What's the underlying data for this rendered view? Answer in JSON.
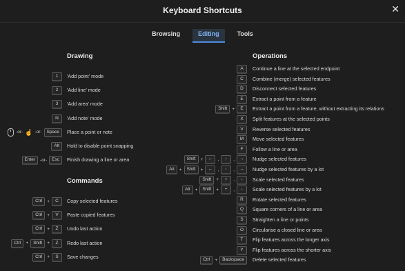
{
  "dialog": {
    "title": "Keyboard Shortcuts",
    "close_icon": "close-icon",
    "close_glyph": "✕"
  },
  "tabs": [
    {
      "label": "Browsing",
      "active": false
    },
    {
      "label": "Editing",
      "active": true
    },
    {
      "label": "Tools",
      "active": false
    }
  ],
  "drawing": {
    "heading": "Drawing",
    "rows": [
      {
        "keys": [
          {
            "k": "1"
          }
        ],
        "desc": "'Add point' mode"
      },
      {
        "keys": [
          {
            "k": "2"
          }
        ],
        "desc": "'Add line' mode"
      },
      {
        "keys": [
          {
            "k": "3"
          }
        ],
        "desc": "'Add area' mode"
      },
      {
        "keys": [
          {
            "k": "N"
          }
        ],
        "desc": "'Add note' mode"
      },
      {
        "keys": [
          {
            "icon": "mouse-icon"
          },
          {
            "sep": "-or-"
          },
          {
            "icon": "hand-pointer-icon"
          },
          {
            "sep": "-or-"
          },
          {
            "k": "Space"
          }
        ],
        "desc": "Place a point or note"
      },
      {
        "keys": [
          {
            "k": "Alt"
          }
        ],
        "desc": "Hold to disable point snapping"
      },
      {
        "keys": [
          {
            "k": "Enter"
          },
          {
            "sep": "-or-"
          },
          {
            "k": "Esc"
          }
        ],
        "desc": "Finish drawing a line or area"
      }
    ]
  },
  "commands": {
    "heading": "Commands",
    "rows": [
      {
        "keys": [
          {
            "k": "Ctrl"
          },
          {
            "sep": "+"
          },
          {
            "k": "C"
          }
        ],
        "desc": "Copy selected features"
      },
      {
        "keys": [
          {
            "k": "Ctrl"
          },
          {
            "sep": "+"
          },
          {
            "k": "V"
          }
        ],
        "desc": "Paste copied features"
      },
      {
        "keys": [
          {
            "k": "Ctrl"
          },
          {
            "sep": "+"
          },
          {
            "k": "Z"
          }
        ],
        "desc": "Undo last action"
      },
      {
        "keys": [
          {
            "k": "Ctrl"
          },
          {
            "sep": "+"
          },
          {
            "k": "Shift"
          },
          {
            "sep": "+"
          },
          {
            "k": "Z"
          }
        ],
        "desc": "Redo last action"
      },
      {
        "keys": [
          {
            "k": "Ctrl"
          },
          {
            "sep": "+"
          },
          {
            "k": "S"
          }
        ],
        "desc": "Save changes"
      }
    ]
  },
  "operations": {
    "heading": "Operations",
    "rows": [
      {
        "keys": [
          {
            "k": "A"
          }
        ],
        "desc": "Continue a line at the selected endpoint"
      },
      {
        "keys": [
          {
            "k": "C"
          }
        ],
        "desc": "Combine (merge) selected features"
      },
      {
        "keys": [
          {
            "k": "D"
          }
        ],
        "desc": "Disconnect selected features"
      },
      {
        "keys": [
          {
            "k": "E"
          }
        ],
        "desc": "Extract a point from a feature"
      },
      {
        "keys": [
          {
            "k": "Shift"
          },
          {
            "sep": "+"
          },
          {
            "k": "E"
          }
        ],
        "desc": "Extract a point from a feature, without extracting its relations"
      },
      {
        "keys": [
          {
            "k": "X"
          }
        ],
        "desc": "Split features at the selected points"
      },
      {
        "keys": [
          {
            "k": "V"
          }
        ],
        "desc": "Reverse selected features"
      },
      {
        "keys": [
          {
            "k": "M"
          }
        ],
        "desc": "Move selected features"
      },
      {
        "keys": [
          {
            "k": "F"
          }
        ],
        "desc": "Follow a line or area"
      },
      {
        "keys": [
          {
            "k": "Shift"
          },
          {
            "sep": "+"
          },
          {
            "k": "←"
          },
          {
            "sep": ","
          },
          {
            "k": "↑"
          },
          {
            "sep": ","
          },
          {
            "k": "→"
          }
        ],
        "desc": "Nudge selected features"
      },
      {
        "keys": [
          {
            "k": "Alt"
          },
          {
            "sep": "+"
          },
          {
            "k": "Shift"
          },
          {
            "sep": "+"
          },
          {
            "k": "←"
          },
          {
            "sep": ","
          },
          {
            "k": "↑"
          },
          {
            "sep": ","
          },
          {
            "k": "→"
          }
        ],
        "desc": "Nudge selected features by a lot"
      },
      {
        "keys": [
          {
            "k": "Shift"
          },
          {
            "sep": "+"
          },
          {
            "k": "+"
          },
          {
            "sep": ","
          },
          {
            "k": "-"
          }
        ],
        "desc": "Scale selected features"
      },
      {
        "keys": [
          {
            "k": "Alt"
          },
          {
            "sep": "+"
          },
          {
            "k": "Shift"
          },
          {
            "sep": "+"
          },
          {
            "k": "+"
          },
          {
            "sep": ","
          },
          {
            "k": "-"
          }
        ],
        "desc": "Scale selected features by a lot"
      },
      {
        "keys": [
          {
            "k": "R"
          }
        ],
        "desc": "Rotate selected features"
      },
      {
        "keys": [
          {
            "k": "Q"
          }
        ],
        "desc": "Square corners of a line or area"
      },
      {
        "keys": [
          {
            "k": "S"
          }
        ],
        "desc": "Straighten a line or points"
      },
      {
        "keys": [
          {
            "k": "O"
          }
        ],
        "desc": "Circularise a closed line or area"
      },
      {
        "keys": [
          {
            "k": "T"
          }
        ],
        "desc": "Flip features across the longer axis"
      },
      {
        "keys": [
          {
            "k": "Y"
          }
        ],
        "desc": "Flip features across the shorter axis"
      },
      {
        "keys": [
          {
            "k": "Ctrl"
          },
          {
            "sep": "+"
          },
          {
            "k": "Backspace"
          }
        ],
        "desc": "Delete selected features"
      }
    ]
  }
}
